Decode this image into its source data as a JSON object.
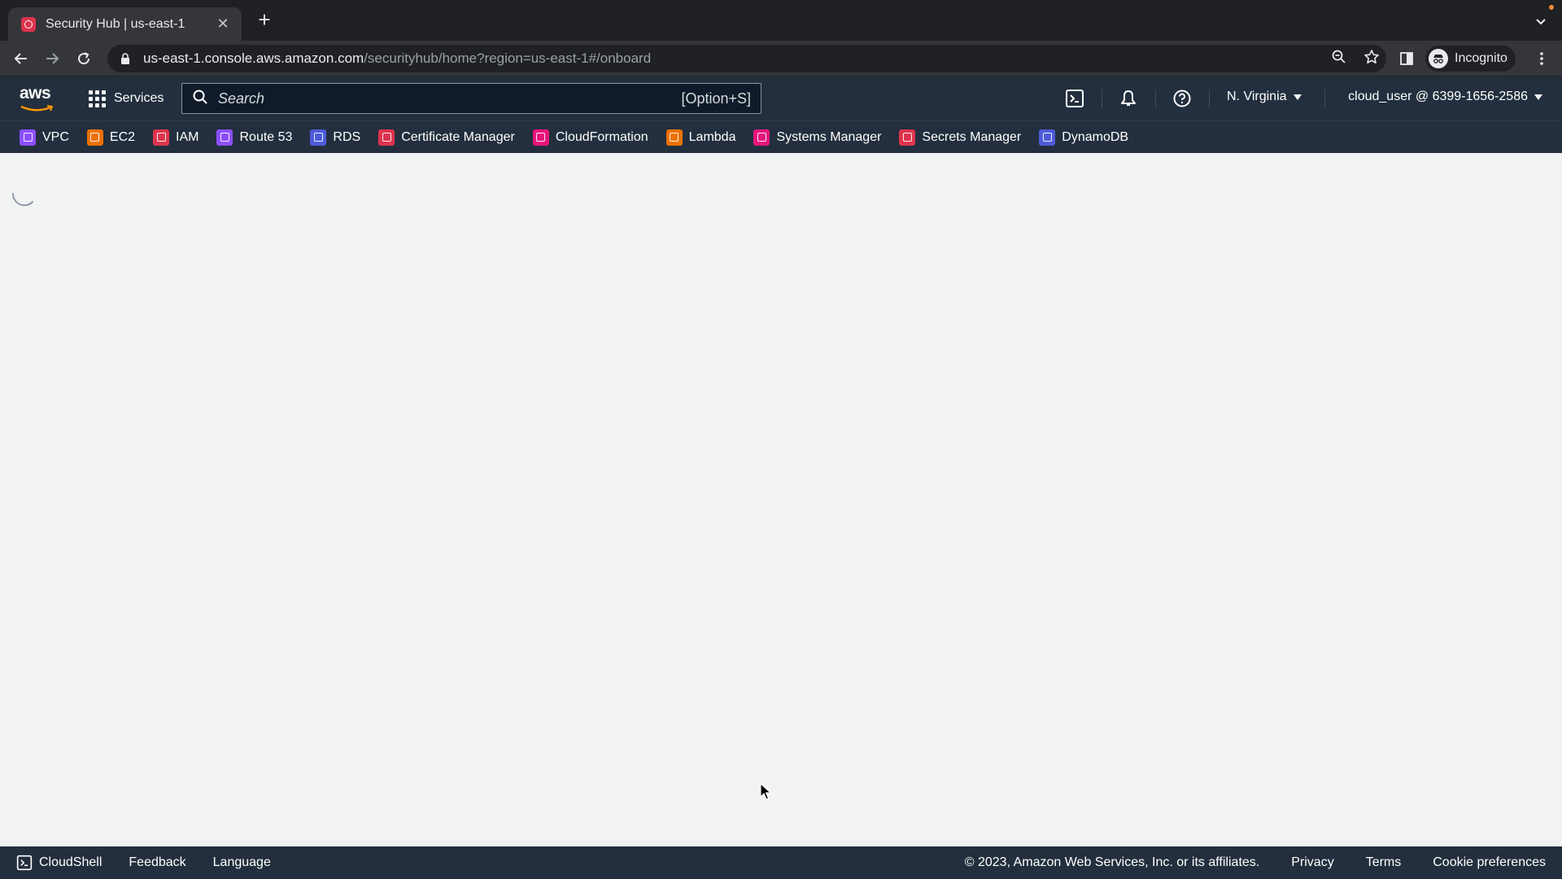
{
  "browser": {
    "tab_title": "Security Hub | us-east-1",
    "url_host": "us-east-1.console.aws.amazon.com",
    "url_path": "/securityhub/home?region=us-east-1#/onboard",
    "profile_label": "Incognito"
  },
  "aws_nav": {
    "logo_text": "aws",
    "services_label": "Services",
    "search_placeholder": "Search",
    "search_shortcut": "[Option+S]",
    "region": "N. Virginia",
    "account": "cloud_user @ 6399-1656-2586"
  },
  "favorites": [
    {
      "label": "VPC",
      "color": "#8c4fff"
    },
    {
      "label": "EC2",
      "color": "#ed7100"
    },
    {
      "label": "IAM",
      "color": "#dd344c"
    },
    {
      "label": "Route 53",
      "color": "#8c4fff"
    },
    {
      "label": "RDS",
      "color": "#4d5bda"
    },
    {
      "label": "Certificate Manager",
      "color": "#dd344c"
    },
    {
      "label": "CloudFormation",
      "color": "#e7157b"
    },
    {
      "label": "Lambda",
      "color": "#ed7100"
    },
    {
      "label": "Systems Manager",
      "color": "#e7157b"
    },
    {
      "label": "Secrets Manager",
      "color": "#dd344c"
    },
    {
      "label": "DynamoDB",
      "color": "#4d5bda"
    }
  ],
  "footer": {
    "cloudshell": "CloudShell",
    "feedback": "Feedback",
    "language": "Language",
    "copyright": "© 2023, Amazon Web Services, Inc. or its affiliates.",
    "privacy": "Privacy",
    "terms": "Terms",
    "cookies": "Cookie preferences"
  },
  "colors": {
    "nav_bg": "#232f3e",
    "page_bg": "#f2f3f3",
    "spinner": "#8d99a8"
  }
}
